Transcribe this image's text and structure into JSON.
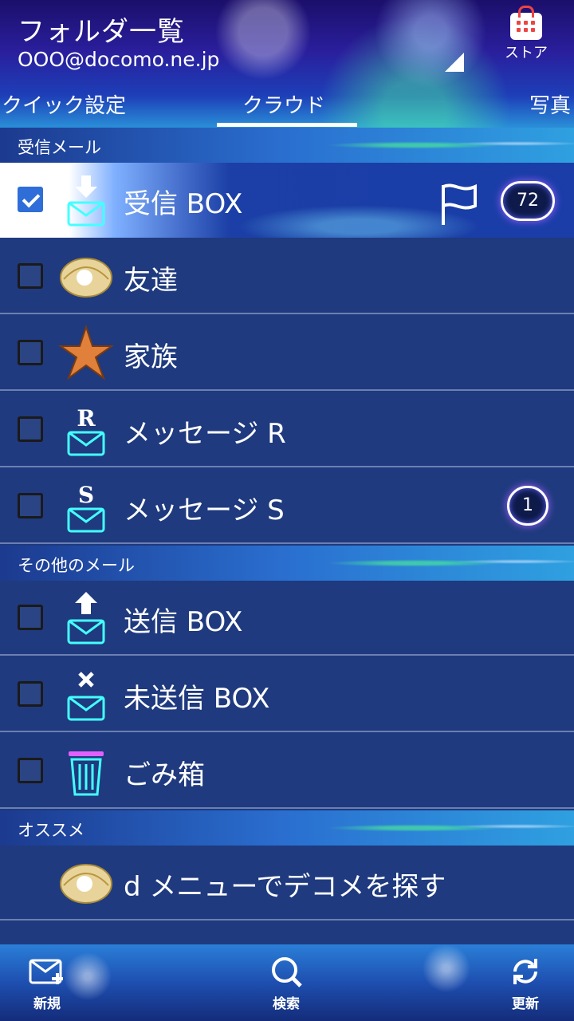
{
  "header": {
    "title": "フォルダ一覧",
    "account": "OOO@docomo.ne.jp",
    "store_label": "ストア"
  },
  "tabs": [
    {
      "label": "クイック設定",
      "active": false
    },
    {
      "label": "クラウド",
      "active": true
    },
    {
      "label": "写真",
      "active": false
    }
  ],
  "sections": {
    "inbox": "受信メール",
    "other": "その他のメール",
    "recommend": "オススメ"
  },
  "folders": [
    {
      "label": "受信 BOX",
      "icon": "inbox-icon",
      "checked": true,
      "badge": "72",
      "flag": true
    },
    {
      "label": "友達",
      "icon": "shell-icon",
      "checked": false
    },
    {
      "label": "家族",
      "icon": "starfish-icon",
      "checked": false
    },
    {
      "label": "メッセージ R",
      "icon": "message-r-icon",
      "checked": false
    },
    {
      "label": "メッセージ S",
      "icon": "message-s-icon",
      "checked": false,
      "badge": "1"
    },
    {
      "label": "送信 BOX",
      "icon": "outbox-icon",
      "checked": false
    },
    {
      "label": "未送信 BOX",
      "icon": "unsent-icon",
      "checked": false
    },
    {
      "label": "ごみ箱",
      "icon": "trash-icon",
      "checked": false
    }
  ],
  "recommend_item": {
    "label": "d メニューでデコメを探す",
    "icon": "shell-icon"
  },
  "bottom_nav": [
    {
      "label": "新規",
      "icon": "compose-icon"
    },
    {
      "label": "検索",
      "icon": "search-icon"
    },
    {
      "label": "更新",
      "icon": "refresh-icon"
    }
  ],
  "colors": {
    "row_bg": "#1f3a7e",
    "divider": "#6b80b3",
    "checkbox_checked": "#2f6ed8",
    "badge_glow": "#a060ff"
  }
}
